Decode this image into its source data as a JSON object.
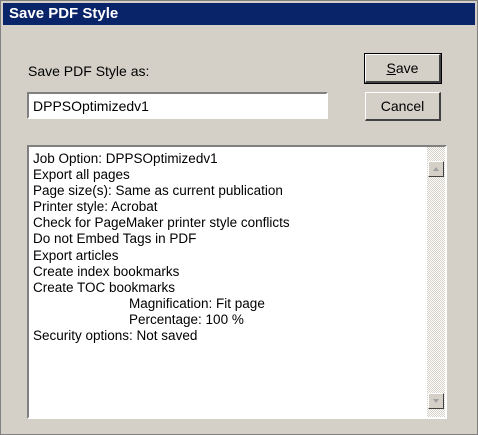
{
  "window": {
    "title": "Save PDF Style"
  },
  "form": {
    "label": "Save PDF Style as:",
    "name_value": "DPPSOptimizedv1"
  },
  "buttons": {
    "save_label_first": "S",
    "save_label_rest": "ave",
    "cancel_label": "Cancel"
  },
  "summary": {
    "lines": [
      "Job Option: DPPSOptimizedv1",
      "Export all pages",
      "Page size(s): Same as current publication",
      "Printer style: Acrobat",
      "Check for PageMaker printer style conflicts",
      "Do not Embed Tags in PDF",
      "Export articles",
      "Create index bookmarks",
      "Create TOC bookmarks",
      "Magnification: Fit page",
      "Percentage: 100 %",
      "Security options: Not saved"
    ]
  },
  "colors": {
    "titlebar": "#0a246a",
    "dialog_bg": "#d4d0c8"
  },
  "icons": {
    "scroll_up": "triangle-up-icon",
    "scroll_down": "triangle-down-icon"
  }
}
